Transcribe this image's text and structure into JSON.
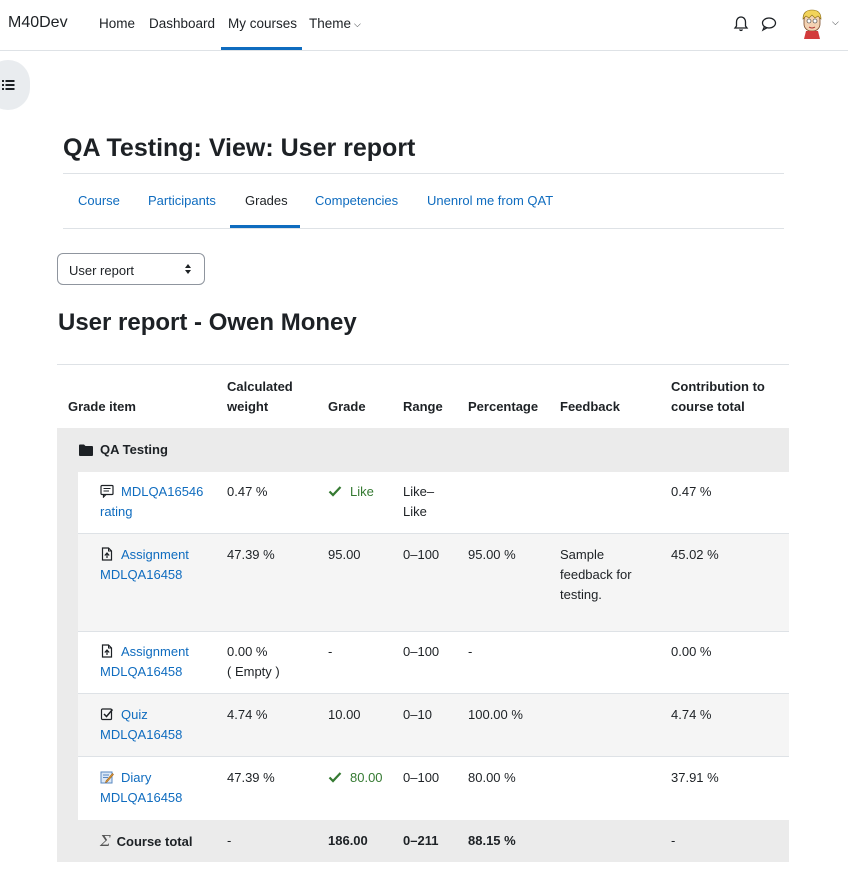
{
  "navbar": {
    "brand": "M40Dev",
    "links": [
      "Home",
      "Dashboard",
      "My courses",
      "Theme"
    ],
    "active": "My courses"
  },
  "page_title": "QA Testing: View: User report",
  "course_tabs": [
    "Course",
    "Participants",
    "Grades",
    "Competencies",
    "Unenrol me from QAT"
  ],
  "active_tab": "Grades",
  "report_select": {
    "value": "User report"
  },
  "report_title": "User report - Owen Money",
  "table": {
    "headers": {
      "grade_item": "Grade item",
      "calculated_weight": [
        "Calculated",
        "weight"
      ],
      "grade": "Grade",
      "range": "Range",
      "percentage": "Percentage",
      "feedback": "Feedback",
      "contribution": [
        "Contribution to",
        "course total"
      ]
    },
    "category": "QA Testing",
    "rows": [
      {
        "icon": "forum-rating-icon",
        "item": [
          "MDLQA16546",
          "rating"
        ],
        "weight": [
          "0.47 %"
        ],
        "grade": "Like",
        "grade_check": true,
        "range": [
          "Like–",
          "Like"
        ],
        "percentage": "",
        "feedback": [],
        "contribution": "0.47 %"
      },
      {
        "icon": "assignment-icon",
        "item": [
          "Assignment",
          "MDLQA16458"
        ],
        "weight": [
          "47.39 %"
        ],
        "grade": "95.00",
        "grade_check": false,
        "range": [
          "0–100"
        ],
        "percentage": "95.00 %",
        "feedback": [
          "Sample",
          "feedback for",
          "testing."
        ],
        "contribution": "45.02 %"
      },
      {
        "icon": "assignment-icon",
        "item": [
          "Assignment",
          "MDLQA16458"
        ],
        "weight": [
          "0.00 %",
          "( Empty )"
        ],
        "grade": "-",
        "grade_check": false,
        "range": [
          "0–100"
        ],
        "percentage": "-",
        "feedback": [],
        "contribution": "0.00 %"
      },
      {
        "icon": "quiz-icon",
        "item": [
          "Quiz",
          "MDLQA16458"
        ],
        "weight": [
          "4.74 %"
        ],
        "grade": "10.00",
        "grade_check": false,
        "range": [
          "0–10"
        ],
        "percentage": "100.00 %",
        "feedback": [],
        "contribution": "4.74 %"
      },
      {
        "icon": "diary-icon",
        "item": [
          "Diary",
          "MDLQA16458"
        ],
        "weight": [
          "47.39 %"
        ],
        "grade": "80.00",
        "grade_check": true,
        "range": [
          "0–100"
        ],
        "percentage": "80.00 %",
        "feedback": [],
        "contribution": "37.91 %"
      }
    ],
    "total": {
      "label": "Course total",
      "weight": "-",
      "grade": "186.00",
      "range": "0–211",
      "percentage": "88.15 %",
      "contribution": "-"
    }
  }
}
